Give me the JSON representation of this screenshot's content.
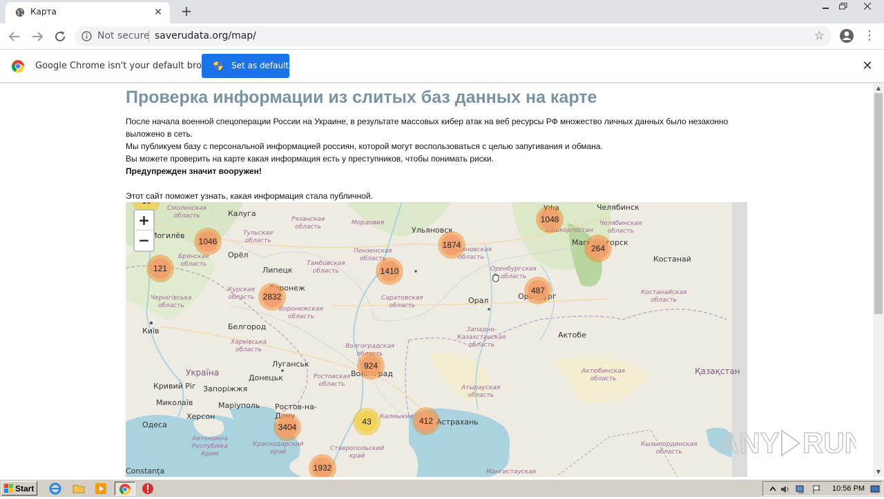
{
  "browser": {
    "tab_title": "Карта",
    "omnibox_security": "Not secure",
    "omnibox_url": "saverudata.org/map/"
  },
  "infobar": {
    "message": "Google Chrome isn't your default browser",
    "button_label": "Set as default"
  },
  "page": {
    "heading": "Проверка информации из слитых баз данных на карте",
    "paragraph_1": "После начала военной спецоперации России на Украине, в результате массовых кибер атак на веб ресурсы РФ множество личных данных было незаконно выложено в сеть.",
    "paragraph_2": "Мы публикуем базу с персональной информацией россиян, которой могут воспользоваться с целью запугивания и обмана.",
    "paragraph_3": "Вы можете проверить на карте какая информация есть у преступников, чтобы понимать риски.",
    "warning": "Предупрежден значит вооружен!",
    "paragraph_4": "Этот сайт поможет узнать, какая информация стала публичной."
  },
  "map": {
    "zoom_in": "+",
    "zoom_out": "−",
    "clusters": [
      "1046",
      "121",
      "2832",
      "1410",
      "1874",
      "1048",
      "264",
      "487",
      "924",
      "43",
      "412",
      "3404",
      "1932",
      "10"
    ],
    "cities": [
      "Калуга",
      "Челябинск",
      "Ульяновск",
      "Магнитогорск",
      "Могилёв",
      "Орёл",
      "Уфа",
      "Липецк",
      "Воронеж",
      "Костанай",
      "Оренбург",
      "Орал",
      "Київ",
      "Белгород",
      "Актобе",
      "Луганськ",
      "Волгоград",
      "Україна",
      "Кривий Ріг",
      "Донецьк",
      "Запоріжжя",
      "Қазақстан",
      "Миколаїв",
      "Маріуполь",
      "Херсон",
      "Ростов-на-Дону",
      "Астрахань",
      "Одеса",
      "Constanța"
    ],
    "regions": [
      "Смоленская область",
      "Рязанская область",
      "Мордовия",
      "Тульская область",
      "Пензенская область",
      "Ульяновская область",
      "Башкортостан",
      "Челябинская область",
      "Брянская область",
      "Тамбовская область",
      "Оренбургская область",
      "Курская область",
      "Саратовская область",
      "Чернігівська область",
      "Воронежская область",
      "Костанайская область",
      "Харківська область",
      "Западно-Казахстанская область",
      "Волгоградская область",
      "Ростовская область",
      "Актюбинская область",
      "Атырауская область",
      "Автономна Республіка Крим",
      "Краснодарский край",
      "Калмыкия",
      "Ставропольский край",
      "Кызылординская область",
      "Мангистауская область"
    ],
    "marker_color_large": "#f18017",
    "marker_color_small": "#f0c20c"
  },
  "taskbar": {
    "start_label": "Start",
    "clock": "10:56 PM"
  },
  "watermark": "ANY RUN"
}
